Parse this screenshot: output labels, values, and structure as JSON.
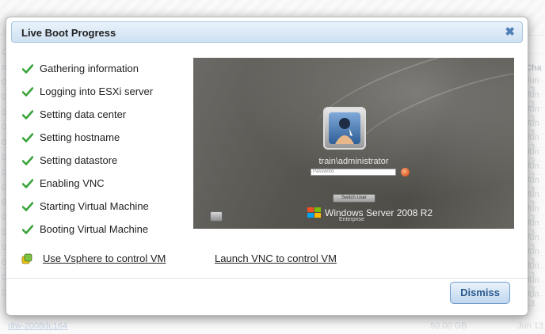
{
  "background": {
    "right_column_header": "Cha",
    "right_column_dates": [
      "Jun 13",
      "Jun 13",
      "Jun 13",
      "Jun 13",
      "Jun 13",
      "Jun 13",
      "Jun 13",
      "Jun 13",
      "Jun 13",
      "Jun 13",
      "Jun 13",
      "Jun 13",
      "Jun 13",
      "Jun 13",
      "Jun 13",
      "Jun 13"
    ],
    "left_column_fragments": [
      "ON",
      "am",
      "0",
      "0",
      "0",
      "0",
      "0",
      "0",
      "0",
      "0",
      "0",
      "0",
      "0",
      "0",
      "0",
      "0",
      "0"
    ],
    "bottom_row": {
      "name": "dtw-2008dc164",
      "size": "50.00 GB",
      "date": "Jun 13"
    }
  },
  "modal": {
    "title": "Live Boot Progress",
    "close_icon": "close-x",
    "steps": [
      {
        "label": "Gathering information",
        "status": "done"
      },
      {
        "label": "Logging into ESXi server",
        "status": "done"
      },
      {
        "label": "Setting data center",
        "status": "done"
      },
      {
        "label": "Setting hostname",
        "status": "done"
      },
      {
        "label": "Setting datastore",
        "status": "done"
      },
      {
        "label": "Enabling VNC",
        "status": "done"
      },
      {
        "label": "Starting Virtual Machine",
        "status": "done"
      },
      {
        "label": "Booting Virtual Machine",
        "status": "done"
      }
    ],
    "check_color": "#3aa33a",
    "vm_screen": {
      "username": "train\\administrator",
      "password_placeholder": "Password",
      "switch_user_label": "Switch User",
      "os_name": "Windows Server 2008 R2",
      "os_edition": "Enterprise"
    },
    "links": {
      "vsphere": "Use Vsphere to control VM",
      "vnc": "Launch VNC to control VM"
    },
    "dismiss_label": "Dismiss",
    "accent_color": "#2a5a8e"
  }
}
